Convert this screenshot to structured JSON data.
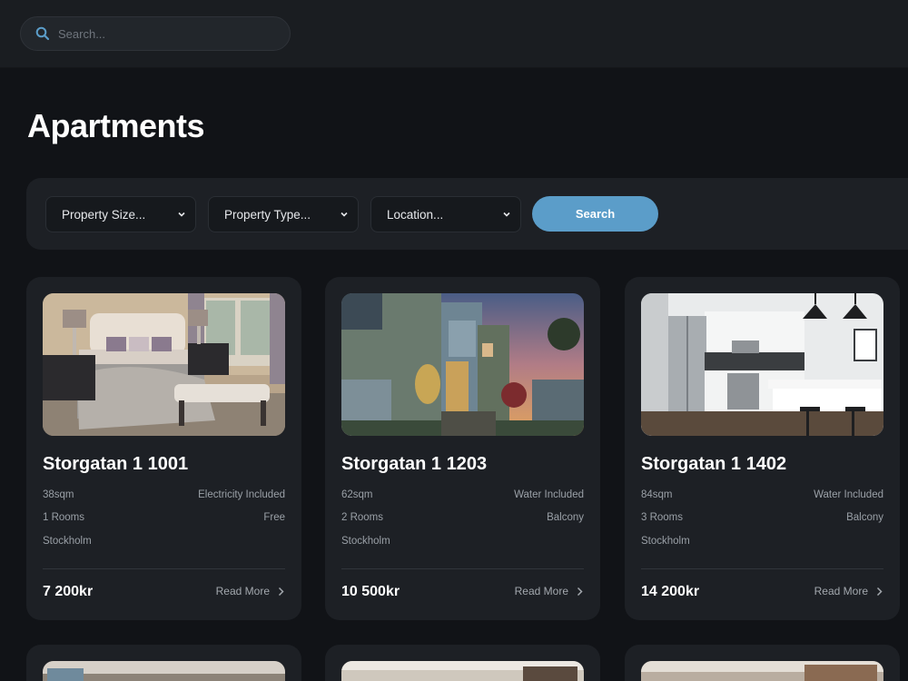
{
  "search": {
    "placeholder": "Search..."
  },
  "page": {
    "title": "Apartments"
  },
  "filters": {
    "property_size": "Property Size...",
    "property_type": "Property Type...",
    "location": "Location...",
    "search_label": "Search"
  },
  "cards": [
    {
      "title": "Storgatan 1 1001",
      "size": "38sqm",
      "rooms": "1 Rooms",
      "city": "Stockholm",
      "feature1": "Electricity Included",
      "feature2": "Free",
      "price": "7 200kr",
      "read_more": "Read More",
      "image": "bedroom-photo"
    },
    {
      "title": "Storgatan 1 1203",
      "size": "62sqm",
      "rooms": "2 Rooms",
      "city": "Stockholm",
      "feature1": "Water Included",
      "feature2": "Balcony",
      "price": "10 500kr",
      "read_more": "Read More",
      "image": "house-exterior-photo"
    },
    {
      "title": "Storgatan 1 1402",
      "size": "84sqm",
      "rooms": "3 Rooms",
      "city": "Stockholm",
      "feature1": "Water Included",
      "feature2": "Balcony",
      "price": "14 200kr",
      "read_more": "Read More",
      "image": "kitchen-photo"
    }
  ],
  "colors": {
    "background": "#111317",
    "surface": "#1d2025",
    "accent": "#5b9dc9"
  }
}
